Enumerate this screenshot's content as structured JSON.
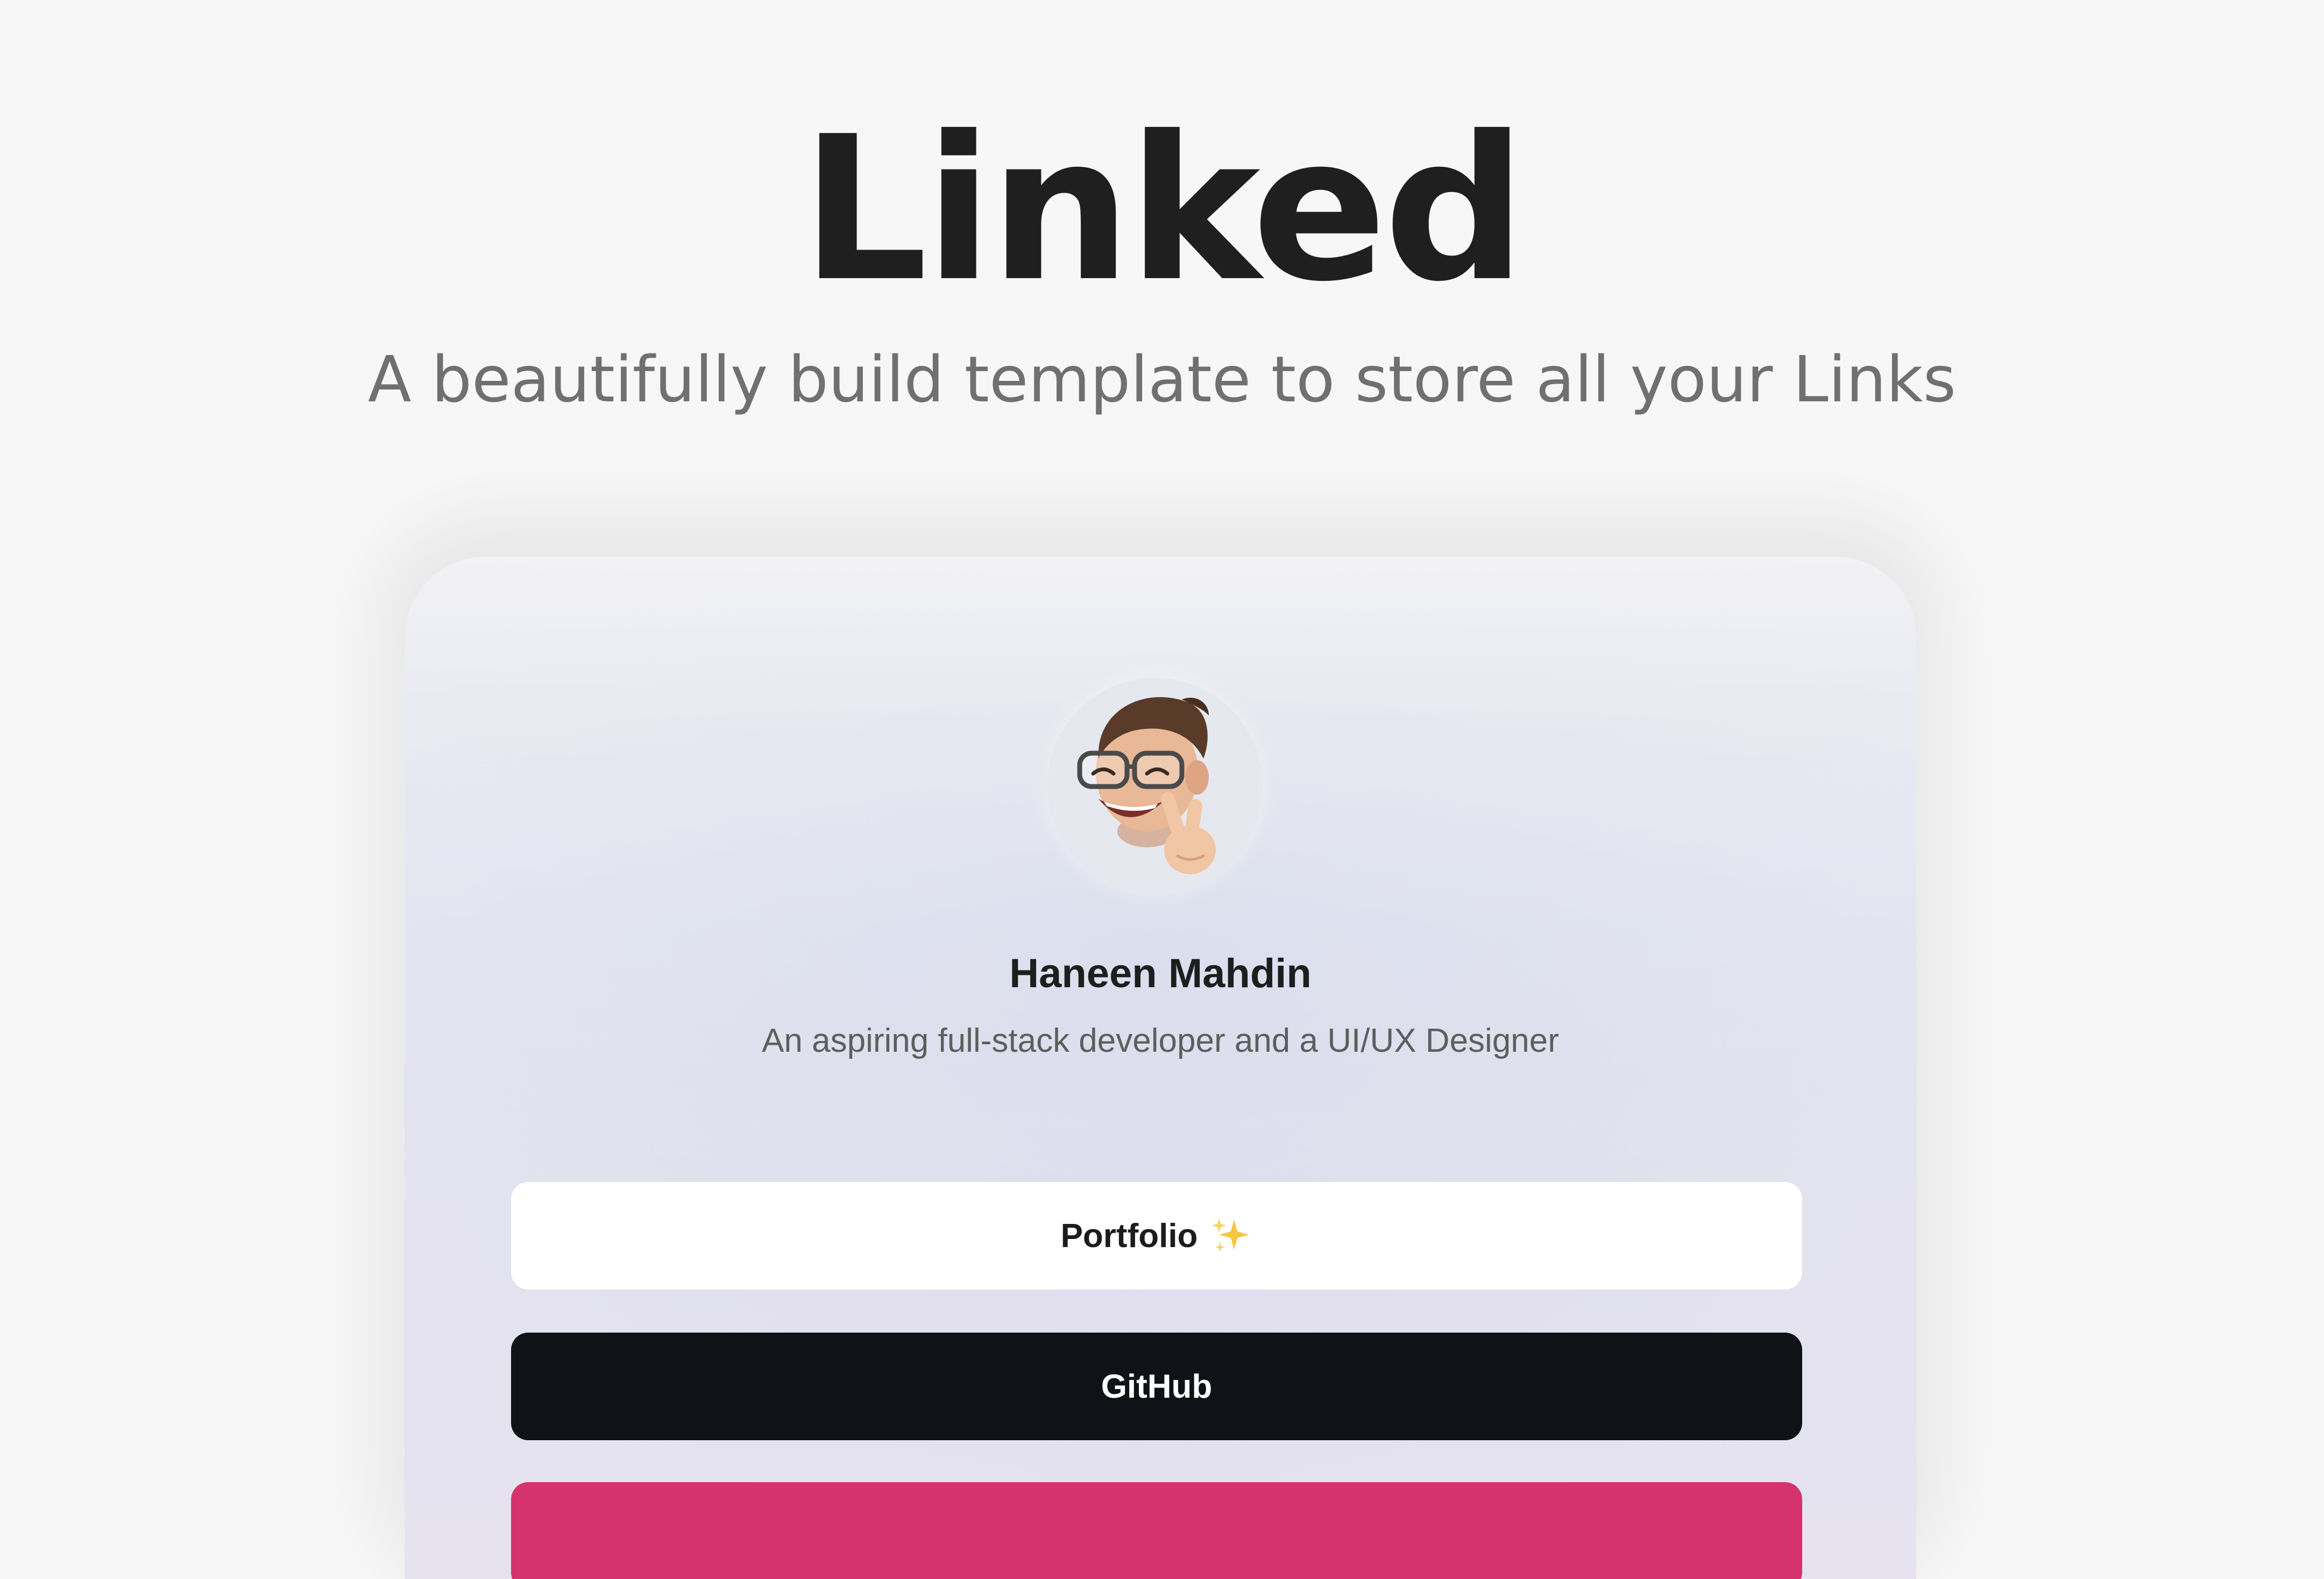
{
  "hero": {
    "title": "Linked",
    "subtitle": "A beautifully build template to store all your Links"
  },
  "profile": {
    "name": "Haneen Mahdin",
    "bio": "An aspiring full-stack developer and a UI/UX Designer",
    "avatar_icon": "memoji-peace-sign-icon"
  },
  "links": [
    {
      "label": "Portfolio",
      "icon": "sparkles-icon"
    },
    {
      "label": "GitHub"
    },
    {
      "label": ""
    }
  ],
  "colors": {
    "page_background": "#f7f7f7",
    "title": "#1f1f1f",
    "subtitle": "#707070",
    "portfolio_button": "#ffffff",
    "github_button": "#0f1216",
    "next_button_accent": "#d6336c"
  }
}
